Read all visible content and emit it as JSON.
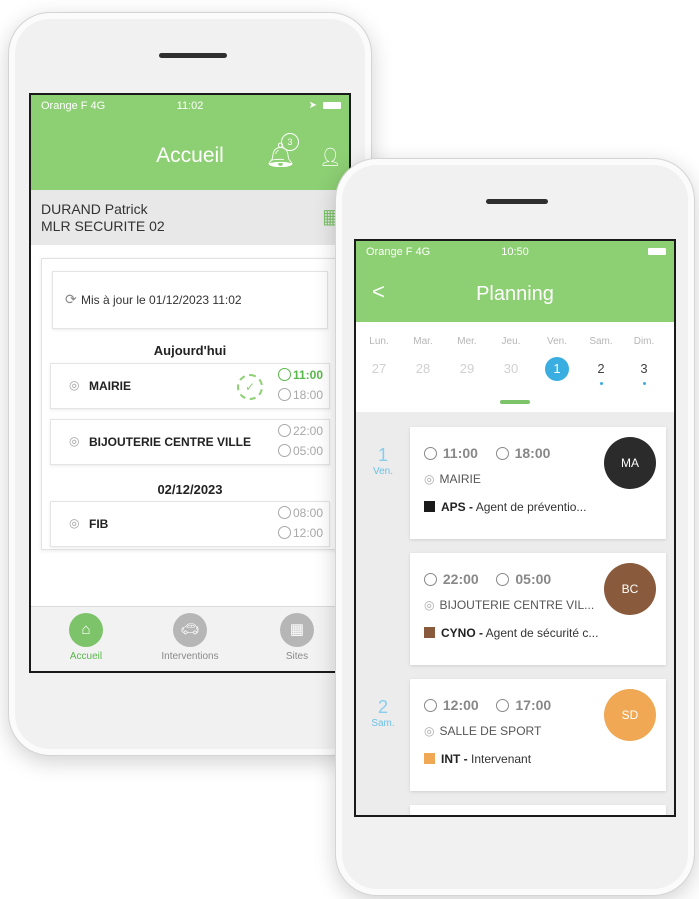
{
  "phone1": {
    "status": {
      "carrier": "Orange F  4G",
      "time": "11:02"
    },
    "header": {
      "title": "Accueil",
      "notification_count": "3"
    },
    "user": {
      "name": "DURAND Patrick",
      "company": "MLR SECURITE 02"
    },
    "update_text": "Mis à jour le 01/12/2023 11:02",
    "sections": [
      {
        "heading": "Aujourd'hui",
        "missions": [
          {
            "site": "MAIRIE",
            "start": "11:00",
            "end": "18:00"
          },
          {
            "site": "BIJOUTERIE CENTRE VILLE",
            "start": "22:00",
            "end": "05:00"
          }
        ]
      },
      {
        "heading": "02/12/2023",
        "missions": [
          {
            "site": "FIB",
            "start": "08:00",
            "end": "12:00"
          }
        ]
      }
    ],
    "nav": [
      {
        "label": "Accueil",
        "icon": "home-icon"
      },
      {
        "label": "Interventions",
        "icon": "car-icon"
      },
      {
        "label": "Sites",
        "icon": "building-icon"
      }
    ]
  },
  "phone2": {
    "status": {
      "carrier": "Orange F  4G",
      "time": "10:50"
    },
    "header": {
      "title": "Planning",
      "back": "<"
    },
    "week": [
      {
        "name": "Lun.",
        "date": "27"
      },
      {
        "name": "Mar.",
        "date": "28"
      },
      {
        "name": "Mer.",
        "date": "29"
      },
      {
        "name": "Jeu.",
        "date": "30"
      },
      {
        "name": "Ven.",
        "date": "1"
      },
      {
        "name": "Sam.",
        "date": "2"
      },
      {
        "name": "Dim.",
        "date": "3"
      }
    ],
    "days": [
      {
        "num": "1",
        "name": "Ven."
      },
      {
        "num": "2",
        "name": "Sam."
      }
    ],
    "cards": [
      {
        "start": "11:00",
        "end": "18:00",
        "site": "MAIRIE",
        "code": "APS -",
        "role": " Agent de préventio...",
        "code_color": "#1a1a1a",
        "initials": "MA",
        "avatar_color": "#2b2b2b"
      },
      {
        "start": "22:00",
        "end": "05:00",
        "site": "BIJOUTERIE CENTRE VIL...",
        "code": "CYNO -",
        "role": " Agent de sécurité c...",
        "code_color": "#8a5a3c",
        "initials": "BC",
        "avatar_color": "#8a5a3c"
      },
      {
        "start": "12:00",
        "end": "17:00",
        "site": "SALLE DE SPORT",
        "code": "INT -",
        "role": " Intervenant",
        "code_color": "#f0a854",
        "initials": "SD",
        "avatar_color": "#f0a854"
      }
    ]
  },
  "colors": {
    "green": "#8dcf73",
    "blue": "#3aaee0"
  }
}
